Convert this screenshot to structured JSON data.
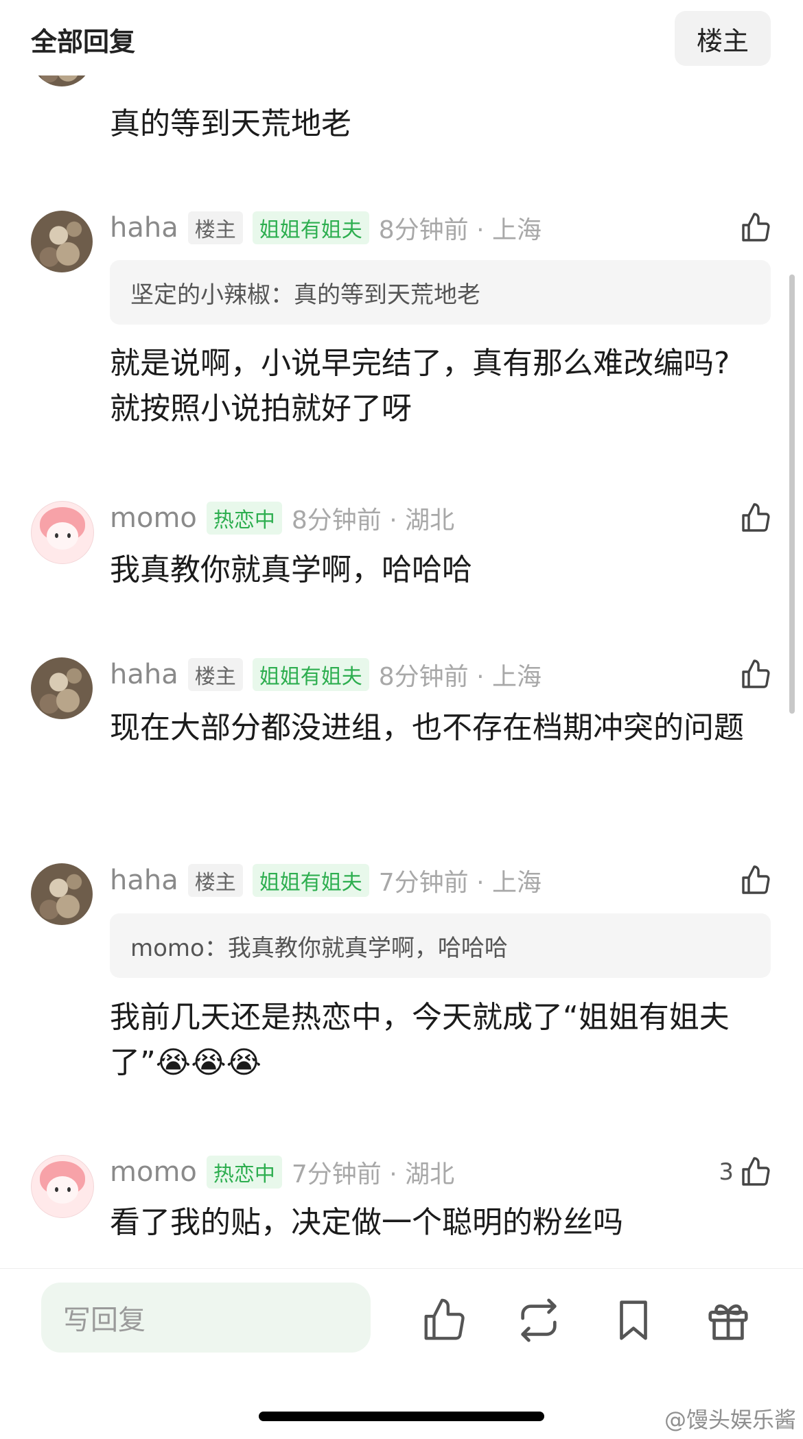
{
  "header": {
    "title": "全部回复",
    "host_button": "楼主"
  },
  "partial_comment": {
    "text": "真的等到天荒地老"
  },
  "comments": [
    {
      "username": "haha",
      "host_tag": "楼主",
      "badge": "姐姐有姐夫",
      "time": "8分钟前 · 上海",
      "quote": "坚定的小辣椒：真的等到天荒地老",
      "text": "就是说啊，小说早完结了，真有那么难改编吗? 就按照小说拍就好了呀"
    },
    {
      "username": "momo",
      "badge": "热恋中",
      "time": "8分钟前 · 湖北",
      "text": "我真教你就真学啊，哈哈哈"
    },
    {
      "username": "haha",
      "host_tag": "楼主",
      "badge": "姐姐有姐夫",
      "time": "8分钟前 · 上海",
      "text": "现在大部分都没进组，也不存在档期冲突的问题"
    },
    {
      "username": "haha",
      "host_tag": "楼主",
      "badge": "姐姐有姐夫",
      "time": "7分钟前 · 上海",
      "quote": "momo：我真教你就真学啊，哈哈哈",
      "text": "我前几天还是热恋中，今天就成了“姐姐有姐夫了”😭😭😭"
    },
    {
      "username": "momo",
      "badge": "热恋中",
      "time": "7分钟前 · 湖北",
      "likes": "3",
      "text": "看了我的贴，决定做一个聪明的粉丝吗"
    }
  ],
  "bottom_bar": {
    "reply_placeholder": "写回复",
    "actions": [
      "thumbs-up-icon",
      "repost-icon",
      "bookmark-icon",
      "gift-icon"
    ]
  },
  "watermark": "@馒头娱乐酱",
  "colors": {
    "badge_green": "#2dae4f",
    "badge_green_bg": "#e8f8eb",
    "reply_bg": "#eef6ef"
  }
}
